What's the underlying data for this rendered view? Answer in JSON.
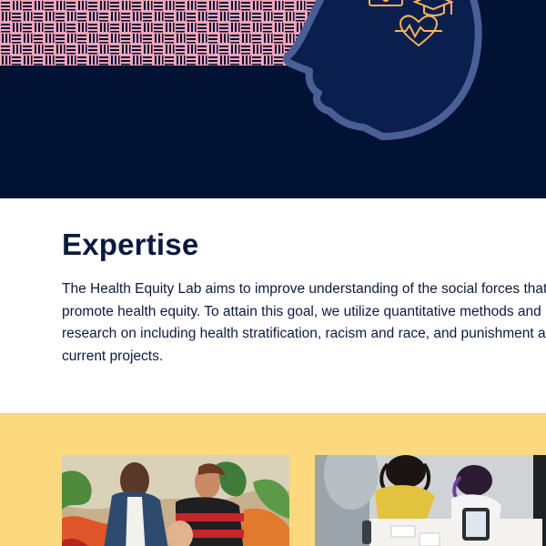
{
  "hero": {
    "pattern_colors": {
      "background": "#f2a6b8",
      "stripe": "#021235"
    },
    "icons": [
      "briefcase-icon",
      "graduation-cap-icon",
      "heart-pulse-icon"
    ],
    "colors": {
      "background": "#021235",
      "head_outline": "#4a5f95",
      "icon_stroke": "#f5b35a"
    }
  },
  "expertise": {
    "title": "Expertise",
    "lines": [
      "The Health Equity Lab aims to improve understanding of the social forces that sh",
      "promote health equity. To attain this goal, we utilize quantitative methods and ins",
      "research on including health stratification, racism and race, and punishment and",
      "current projects."
    ]
  },
  "cards": {
    "background": "#fcd97e",
    "images": [
      "women-mural-photo",
      "team-meeting-photo"
    ]
  }
}
